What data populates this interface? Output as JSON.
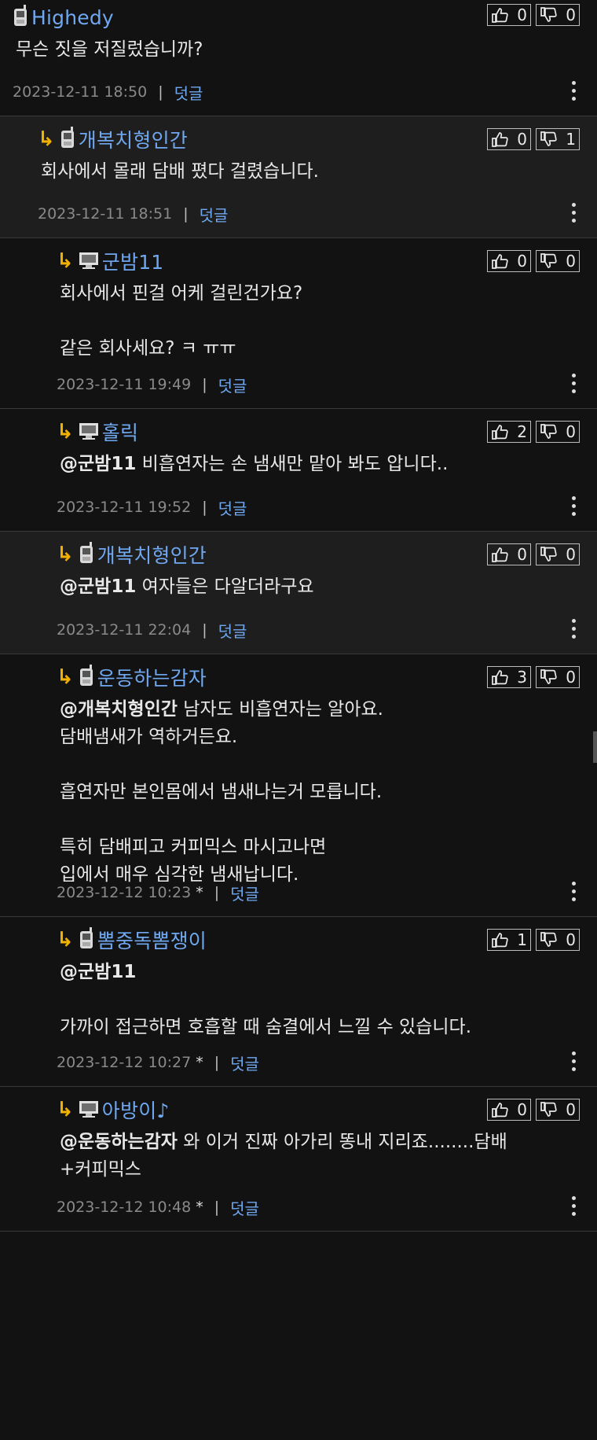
{
  "comments": [
    {
      "author": "Highedy",
      "device": "phone",
      "reply": false,
      "up": "0",
      "down": "0",
      "mention": "",
      "text": "무슨 짓을 저질렀습니까?",
      "date": "2023-12-11 18:50",
      "edited": "",
      "reply_label": "덧글"
    },
    {
      "author": "개복치형인간",
      "device": "phone",
      "reply": true,
      "up": "0",
      "down": "1",
      "mention": "",
      "text": "회사에서 몰래 담배 폈다 걸렸습니다.",
      "date": "2023-12-11 18:51",
      "edited": "",
      "reply_label": "덧글"
    },
    {
      "author": "군밤11",
      "device": "pc",
      "reply": true,
      "up": "0",
      "down": "0",
      "mention": "",
      "text": "회사에서 핀걸 어케 걸린건가요?\n\n같은 회사세요? ㅋ ㅠㅠ",
      "date": "2023-12-11 19:49",
      "edited": "",
      "reply_label": "덧글"
    },
    {
      "author": "홀릭",
      "device": "pc",
      "reply": true,
      "up": "2",
      "down": "0",
      "mention": "@군밤11",
      "text": " 비흡연자는 손 냄새만 맡아 봐도 압니다..",
      "date": "2023-12-11 19:52",
      "edited": "",
      "reply_label": "덧글"
    },
    {
      "author": "개복치형인간",
      "device": "phone",
      "reply": true,
      "up": "0",
      "down": "0",
      "mention": "@군밤11",
      "text": " 여자들은 다알더라구요",
      "date": "2023-12-11 22:04",
      "edited": "",
      "reply_label": "덧글"
    },
    {
      "author": "운동하는감자",
      "device": "phone",
      "reply": true,
      "up": "3",
      "down": "0",
      "mention": "@개복치형인간",
      "text": " 남자도 비흡연자는 알아요.\n담배냄새가 역하거든요.\n\n흡연자만 본인몸에서  냄새나는거 모릅니다.\n\n특히  담배피고  커피믹스 마시고나면\n입에서 매우 심각한 냄새납니다.",
      "date": "2023-12-12 10:23",
      "edited": "*",
      "reply_label": "덧글"
    },
    {
      "author": "뽐중독뽐쟁이",
      "device": "phone",
      "reply": true,
      "up": "1",
      "down": "0",
      "mention": "@군밤11",
      "text": "\n\n가까이 접근하면 호흡할 때 숨결에서 느낄 수 있습니다.",
      "date": "2023-12-12 10:27",
      "edited": "*",
      "reply_label": "덧글"
    },
    {
      "author": "아방이♪",
      "device": "pc",
      "reply": true,
      "up": "0",
      "down": "0",
      "mention": "@운동하는감자",
      "text": " 와 이거 진짜 아가리 똥내 지리죠........담배\n+커피믹스",
      "date": "2023-12-12 10:48",
      "edited": "*",
      "reply_label": "덧글"
    }
  ]
}
